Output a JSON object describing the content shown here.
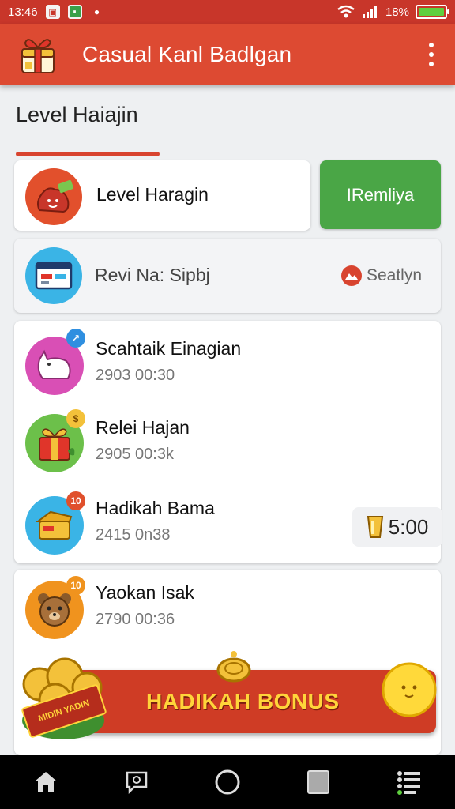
{
  "status_bar": {
    "time": "13:46",
    "battery": "18%"
  },
  "app_bar": {
    "title": "Casual Kanl Badlgan"
  },
  "section": {
    "title": "Level Haiajin"
  },
  "level_card": {
    "name": "Level Haragin",
    "action_label": "IRemliya"
  },
  "review_card": {
    "text": "Revi Na: Sipbj",
    "link_label": "Seatlyn"
  },
  "list": [
    {
      "name": "Scahtaik Einagian",
      "meta": "2903 00:30",
      "badge": ""
    },
    {
      "name": "Relei Hajan",
      "meta": "2905 00:3k",
      "badge": ""
    },
    {
      "name": "Hadikah Bama",
      "meta": "2415 0n38",
      "badge": "10",
      "price": "5:00"
    }
  ],
  "list2": [
    {
      "name": "Yaokan Isak",
      "meta": "2790 00:36",
      "badge": "10"
    }
  ],
  "bonus": {
    "label": "HADIKAH BONUS",
    "ribbon": "MIDIN YADIN"
  },
  "colors": {
    "primary": "#dd4a32",
    "status_bar": "#c8362a",
    "accent_green": "#4aa646",
    "bonus_text": "#ffd43a"
  }
}
